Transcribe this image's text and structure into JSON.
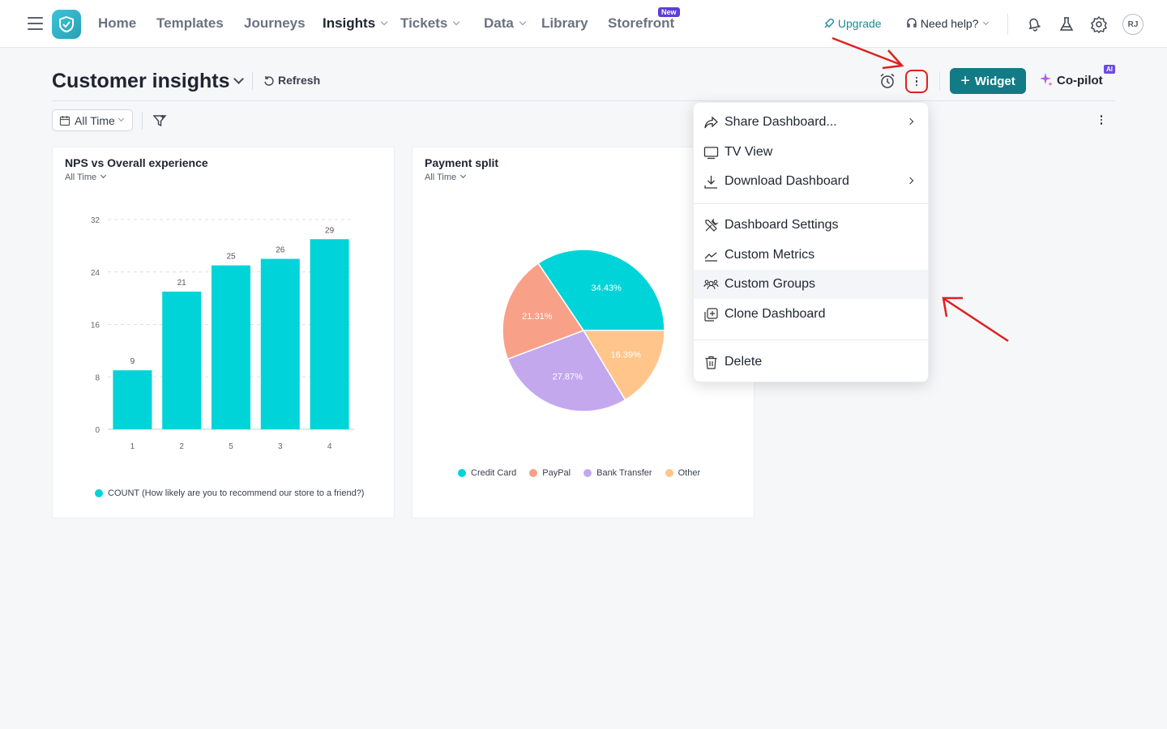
{
  "nav": {
    "items": [
      {
        "label": "Home"
      },
      {
        "label": "Templates"
      },
      {
        "label": "Journeys"
      },
      {
        "label": "Insights"
      },
      {
        "label": "Tickets"
      },
      {
        "label": "Data"
      },
      {
        "label": "Library"
      },
      {
        "label": "Storefront"
      }
    ],
    "new_badge": "New",
    "upgrade": "Upgrade",
    "need_help": "Need help?",
    "avatar_initials": "RJ"
  },
  "header": {
    "title": "Customer insights",
    "refresh": "Refresh",
    "widget": "Widget",
    "copilot": "Co-pilot",
    "ai_badge": "AI"
  },
  "filters": {
    "time": "All Time"
  },
  "cards": [
    {
      "title": "NPS vs Overall experience",
      "subtitle": "All Time",
      "legend": "COUNT (How likely are you to recommend our store to a friend?)"
    },
    {
      "title": "Payment split",
      "subtitle": "All Time"
    }
  ],
  "chart_data": [
    {
      "type": "bar",
      "title": "NPS vs Overall experience",
      "categories": [
        "1",
        "2",
        "5",
        "3",
        "4"
      ],
      "values": [
        9,
        21,
        25,
        26,
        29
      ],
      "yticks": [
        0,
        8,
        16,
        24,
        32
      ],
      "ylim": [
        0,
        32
      ],
      "series": [
        {
          "name": "COUNT (How likely are you to recommend our store to a friend?)",
          "values": [
            9,
            21,
            25,
            26,
            29
          ]
        }
      ],
      "color": "#00d4d8",
      "grid": true,
      "legend": "bottom"
    },
    {
      "type": "pie",
      "title": "Payment split",
      "slices": [
        {
          "label": "Credit Card",
          "value": 34.43,
          "text": "34.43%",
          "color": "#00d4d8"
        },
        {
          "label": "Other",
          "value": 16.39,
          "text": "16.39%",
          "color": "#ffc58a"
        },
        {
          "label": "Bank Transfer",
          "value": 27.87,
          "text": "27.87%",
          "color": "#c3a8ee"
        },
        {
          "label": "PayPal",
          "value": 21.31,
          "text": "21.31%",
          "color": "#f9a088"
        }
      ],
      "legend_order": [
        "Credit Card",
        "PayPal",
        "Bank Transfer",
        "Other"
      ],
      "legend": "bottom"
    }
  ],
  "menu": {
    "items": [
      {
        "label": "Share Dashboard...",
        "icon": "share-icon",
        "submenu": true
      },
      {
        "label": "TV View",
        "icon": "monitor-icon",
        "submenu": false
      },
      {
        "label": "Download Dashboard",
        "icon": "download-icon",
        "submenu": true
      },
      {
        "label": "Dashboard Settings",
        "icon": "tools-icon",
        "submenu": false
      },
      {
        "label": "Custom Metrics",
        "icon": "trend-icon",
        "submenu": false
      },
      {
        "label": "Custom Groups",
        "icon": "group-icon",
        "submenu": false,
        "highlighted": true
      },
      {
        "label": "Clone Dashboard",
        "icon": "clone-icon",
        "submenu": false
      },
      {
        "label": "Delete",
        "icon": "trash-icon",
        "submenu": false
      }
    ]
  },
  "colors": {
    "accent": "#127b86",
    "annotation": "#e0201e",
    "badge": "#5b3fd6"
  }
}
